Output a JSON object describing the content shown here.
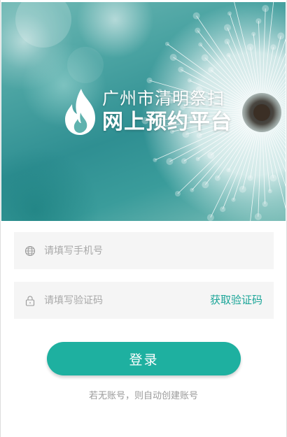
{
  "hero": {
    "title_line1": "广州市清明祭扫",
    "title_line2": "网上预约平台"
  },
  "form": {
    "phone_placeholder": "请填写手机号",
    "code_placeholder": "请填写验证码",
    "get_code_label": "获取验证码",
    "login_label": "登录",
    "hint": "若无账号，则自动创建账号"
  },
  "icons": {
    "logo": "flame-icon",
    "phone_field": "globe-icon",
    "code_field": "lock-icon"
  },
  "colors": {
    "accent": "#1eb0a0",
    "link": "#1aa598",
    "field_bg": "#f5f5f5",
    "hint": "#9a9a9a"
  }
}
